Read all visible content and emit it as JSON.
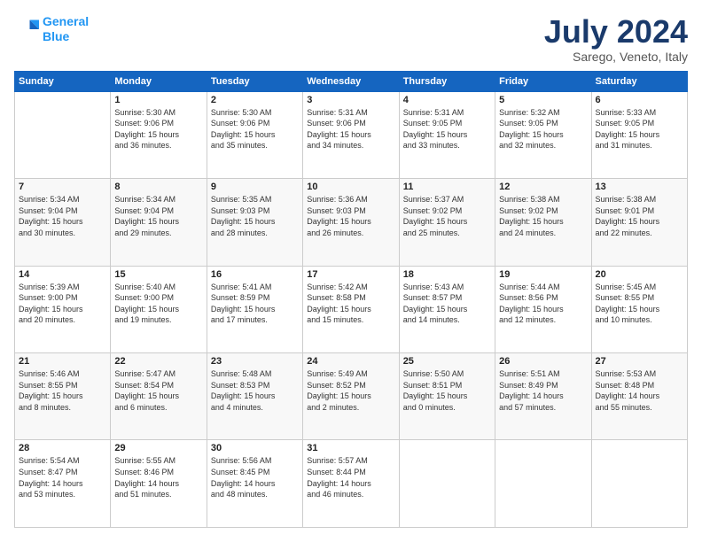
{
  "logo": {
    "line1": "General",
    "line2": "Blue"
  },
  "header": {
    "month": "July 2024",
    "location": "Sarego, Veneto, Italy"
  },
  "days_of_week": [
    "Sunday",
    "Monday",
    "Tuesday",
    "Wednesday",
    "Thursday",
    "Friday",
    "Saturday"
  ],
  "weeks": [
    [
      {
        "day": "",
        "info": ""
      },
      {
        "day": "1",
        "info": "Sunrise: 5:30 AM\nSunset: 9:06 PM\nDaylight: 15 hours\nand 36 minutes."
      },
      {
        "day": "2",
        "info": "Sunrise: 5:30 AM\nSunset: 9:06 PM\nDaylight: 15 hours\nand 35 minutes."
      },
      {
        "day": "3",
        "info": "Sunrise: 5:31 AM\nSunset: 9:06 PM\nDaylight: 15 hours\nand 34 minutes."
      },
      {
        "day": "4",
        "info": "Sunrise: 5:31 AM\nSunset: 9:05 PM\nDaylight: 15 hours\nand 33 minutes."
      },
      {
        "day": "5",
        "info": "Sunrise: 5:32 AM\nSunset: 9:05 PM\nDaylight: 15 hours\nand 32 minutes."
      },
      {
        "day": "6",
        "info": "Sunrise: 5:33 AM\nSunset: 9:05 PM\nDaylight: 15 hours\nand 31 minutes."
      }
    ],
    [
      {
        "day": "7",
        "info": "Sunrise: 5:34 AM\nSunset: 9:04 PM\nDaylight: 15 hours\nand 30 minutes."
      },
      {
        "day": "8",
        "info": "Sunrise: 5:34 AM\nSunset: 9:04 PM\nDaylight: 15 hours\nand 29 minutes."
      },
      {
        "day": "9",
        "info": "Sunrise: 5:35 AM\nSunset: 9:03 PM\nDaylight: 15 hours\nand 28 minutes."
      },
      {
        "day": "10",
        "info": "Sunrise: 5:36 AM\nSunset: 9:03 PM\nDaylight: 15 hours\nand 26 minutes."
      },
      {
        "day": "11",
        "info": "Sunrise: 5:37 AM\nSunset: 9:02 PM\nDaylight: 15 hours\nand 25 minutes."
      },
      {
        "day": "12",
        "info": "Sunrise: 5:38 AM\nSunset: 9:02 PM\nDaylight: 15 hours\nand 24 minutes."
      },
      {
        "day": "13",
        "info": "Sunrise: 5:38 AM\nSunset: 9:01 PM\nDaylight: 15 hours\nand 22 minutes."
      }
    ],
    [
      {
        "day": "14",
        "info": "Sunrise: 5:39 AM\nSunset: 9:00 PM\nDaylight: 15 hours\nand 20 minutes."
      },
      {
        "day": "15",
        "info": "Sunrise: 5:40 AM\nSunset: 9:00 PM\nDaylight: 15 hours\nand 19 minutes."
      },
      {
        "day": "16",
        "info": "Sunrise: 5:41 AM\nSunset: 8:59 PM\nDaylight: 15 hours\nand 17 minutes."
      },
      {
        "day": "17",
        "info": "Sunrise: 5:42 AM\nSunset: 8:58 PM\nDaylight: 15 hours\nand 15 minutes."
      },
      {
        "day": "18",
        "info": "Sunrise: 5:43 AM\nSunset: 8:57 PM\nDaylight: 15 hours\nand 14 minutes."
      },
      {
        "day": "19",
        "info": "Sunrise: 5:44 AM\nSunset: 8:56 PM\nDaylight: 15 hours\nand 12 minutes."
      },
      {
        "day": "20",
        "info": "Sunrise: 5:45 AM\nSunset: 8:55 PM\nDaylight: 15 hours\nand 10 minutes."
      }
    ],
    [
      {
        "day": "21",
        "info": "Sunrise: 5:46 AM\nSunset: 8:55 PM\nDaylight: 15 hours\nand 8 minutes."
      },
      {
        "day": "22",
        "info": "Sunrise: 5:47 AM\nSunset: 8:54 PM\nDaylight: 15 hours\nand 6 minutes."
      },
      {
        "day": "23",
        "info": "Sunrise: 5:48 AM\nSunset: 8:53 PM\nDaylight: 15 hours\nand 4 minutes."
      },
      {
        "day": "24",
        "info": "Sunrise: 5:49 AM\nSunset: 8:52 PM\nDaylight: 15 hours\nand 2 minutes."
      },
      {
        "day": "25",
        "info": "Sunrise: 5:50 AM\nSunset: 8:51 PM\nDaylight: 15 hours\nand 0 minutes."
      },
      {
        "day": "26",
        "info": "Sunrise: 5:51 AM\nSunset: 8:49 PM\nDaylight: 14 hours\nand 57 minutes."
      },
      {
        "day": "27",
        "info": "Sunrise: 5:53 AM\nSunset: 8:48 PM\nDaylight: 14 hours\nand 55 minutes."
      }
    ],
    [
      {
        "day": "28",
        "info": "Sunrise: 5:54 AM\nSunset: 8:47 PM\nDaylight: 14 hours\nand 53 minutes."
      },
      {
        "day": "29",
        "info": "Sunrise: 5:55 AM\nSunset: 8:46 PM\nDaylight: 14 hours\nand 51 minutes."
      },
      {
        "day": "30",
        "info": "Sunrise: 5:56 AM\nSunset: 8:45 PM\nDaylight: 14 hours\nand 48 minutes."
      },
      {
        "day": "31",
        "info": "Sunrise: 5:57 AM\nSunset: 8:44 PM\nDaylight: 14 hours\nand 46 minutes."
      },
      {
        "day": "",
        "info": ""
      },
      {
        "day": "",
        "info": ""
      },
      {
        "day": "",
        "info": ""
      }
    ]
  ]
}
